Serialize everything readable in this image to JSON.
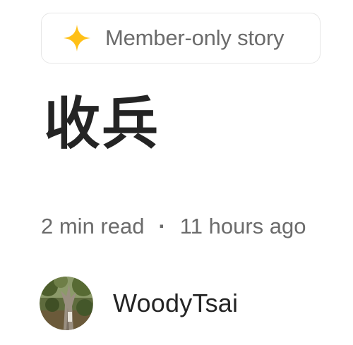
{
  "badge": {
    "icon": "sparkle-star-icon",
    "icon_color": "#FFC017",
    "label": "Member-only story"
  },
  "title": "收兵",
  "meta": {
    "read_time": "2 min read",
    "separator": "·",
    "posted": "11 hours ago"
  },
  "author": {
    "avatar_icon": "avatar-tree-photo",
    "name": "WoodyTsai"
  }
}
